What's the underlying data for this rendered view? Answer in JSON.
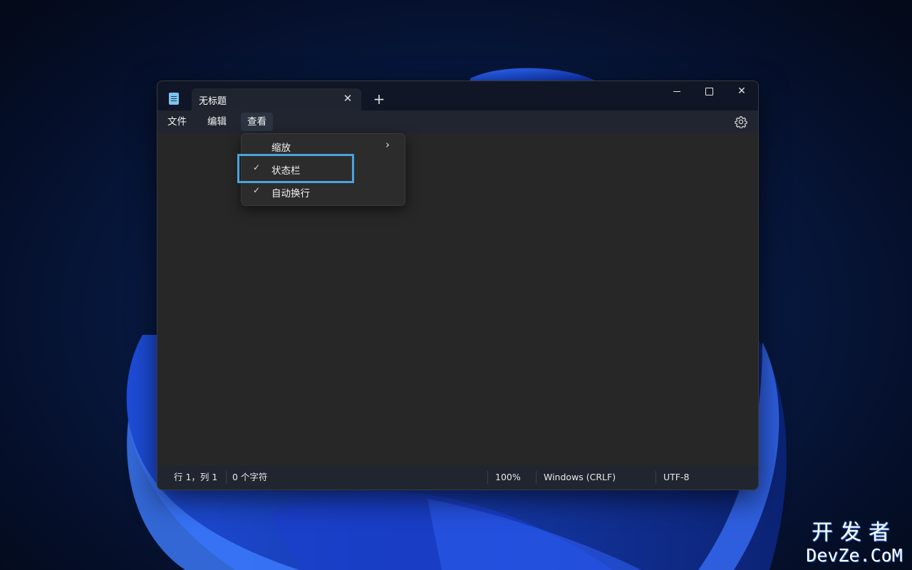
{
  "window": {
    "tab_title": "无标题",
    "tab_close_glyph": "✕",
    "tab_add_glyph": "+",
    "minimize_glyph": "—",
    "close_glyph": "✕",
    "app_icon": "notepad-icon"
  },
  "menu": {
    "items": [
      {
        "label": "文件"
      },
      {
        "label": "编辑"
      },
      {
        "label": "查看",
        "active": true
      }
    ],
    "settings_icon": "gear-icon"
  },
  "dropdown": {
    "items": [
      {
        "label": "缩放",
        "checked": false,
        "submenu": true
      },
      {
        "label": "状态栏",
        "checked": true,
        "submenu": false
      },
      {
        "label": "自动换行",
        "checked": true,
        "submenu": false
      }
    ],
    "check_glyph": "✓",
    "submenu_glyph": "›"
  },
  "status": {
    "position": "行 1，列 1",
    "chars": "0 个字符",
    "zoom": "100%",
    "line_ending": "Windows (CRLF)",
    "encoding": "UTF-8"
  },
  "watermark": {
    "cn": "开发者",
    "en": "DevZe.CoM"
  },
  "colors": {
    "highlight": "#4aa3df",
    "titlebar": "#101625",
    "editor": "#272727"
  }
}
